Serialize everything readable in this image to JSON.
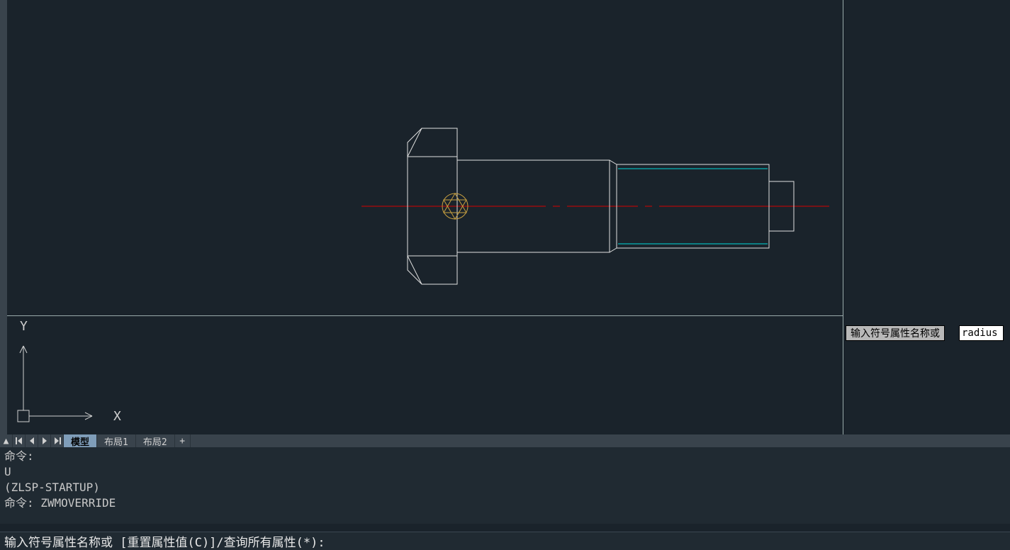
{
  "colors": {
    "bg": "#1a232b",
    "geom": "#e0e0e0",
    "center": "#d40000",
    "thread": "#00d8d8",
    "marker": "#c8a040"
  },
  "axes": {
    "x_label": "X",
    "y_label": "Y"
  },
  "tooltip": {
    "label": "输入符号属性名称或"
  },
  "input": {
    "value": "radius"
  },
  "tabs": {
    "nav_up": "▲",
    "add": "+",
    "items": [
      {
        "label": "模型",
        "active": true
      },
      {
        "label": "布局1",
        "active": false
      },
      {
        "label": "布局2",
        "active": false
      }
    ]
  },
  "history": {
    "lines": [
      "命令:",
      "U",
      "(ZLSP-STARTUP)",
      "命令: ZWMOVERRIDE"
    ]
  },
  "prompt": {
    "text": "输入符号属性名称或 [重置属性值(C)]/查询所有属性(*):"
  }
}
